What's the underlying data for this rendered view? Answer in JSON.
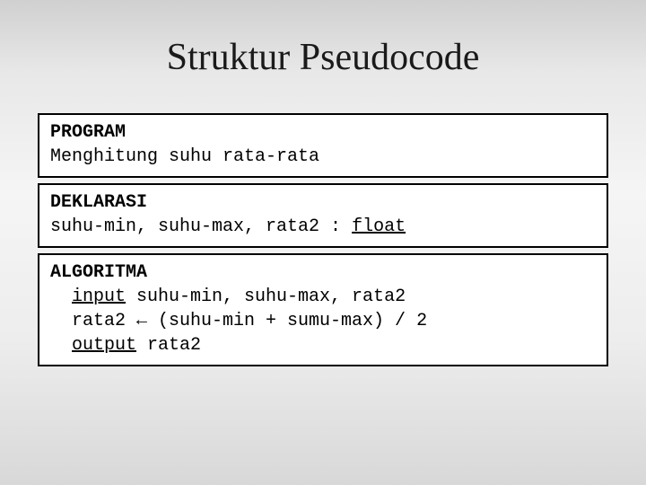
{
  "title": "Struktur Pseudocode",
  "program": {
    "heading": "PROGRAM",
    "body": "Menghitung suhu rata-rata"
  },
  "deklarasi": {
    "heading": "DEKLARASI",
    "vars": "suhu-min, suhu-max, rata2 : ",
    "type": "float"
  },
  "algoritma": {
    "heading": "ALGORITMA",
    "input_kw": "input",
    "input_rest": " suhu-min, suhu-max, rata2",
    "assign": "rata2 ← (suhu-min + sumu-max) / 2",
    "output_kw": "output",
    "output_rest": " rata2"
  }
}
